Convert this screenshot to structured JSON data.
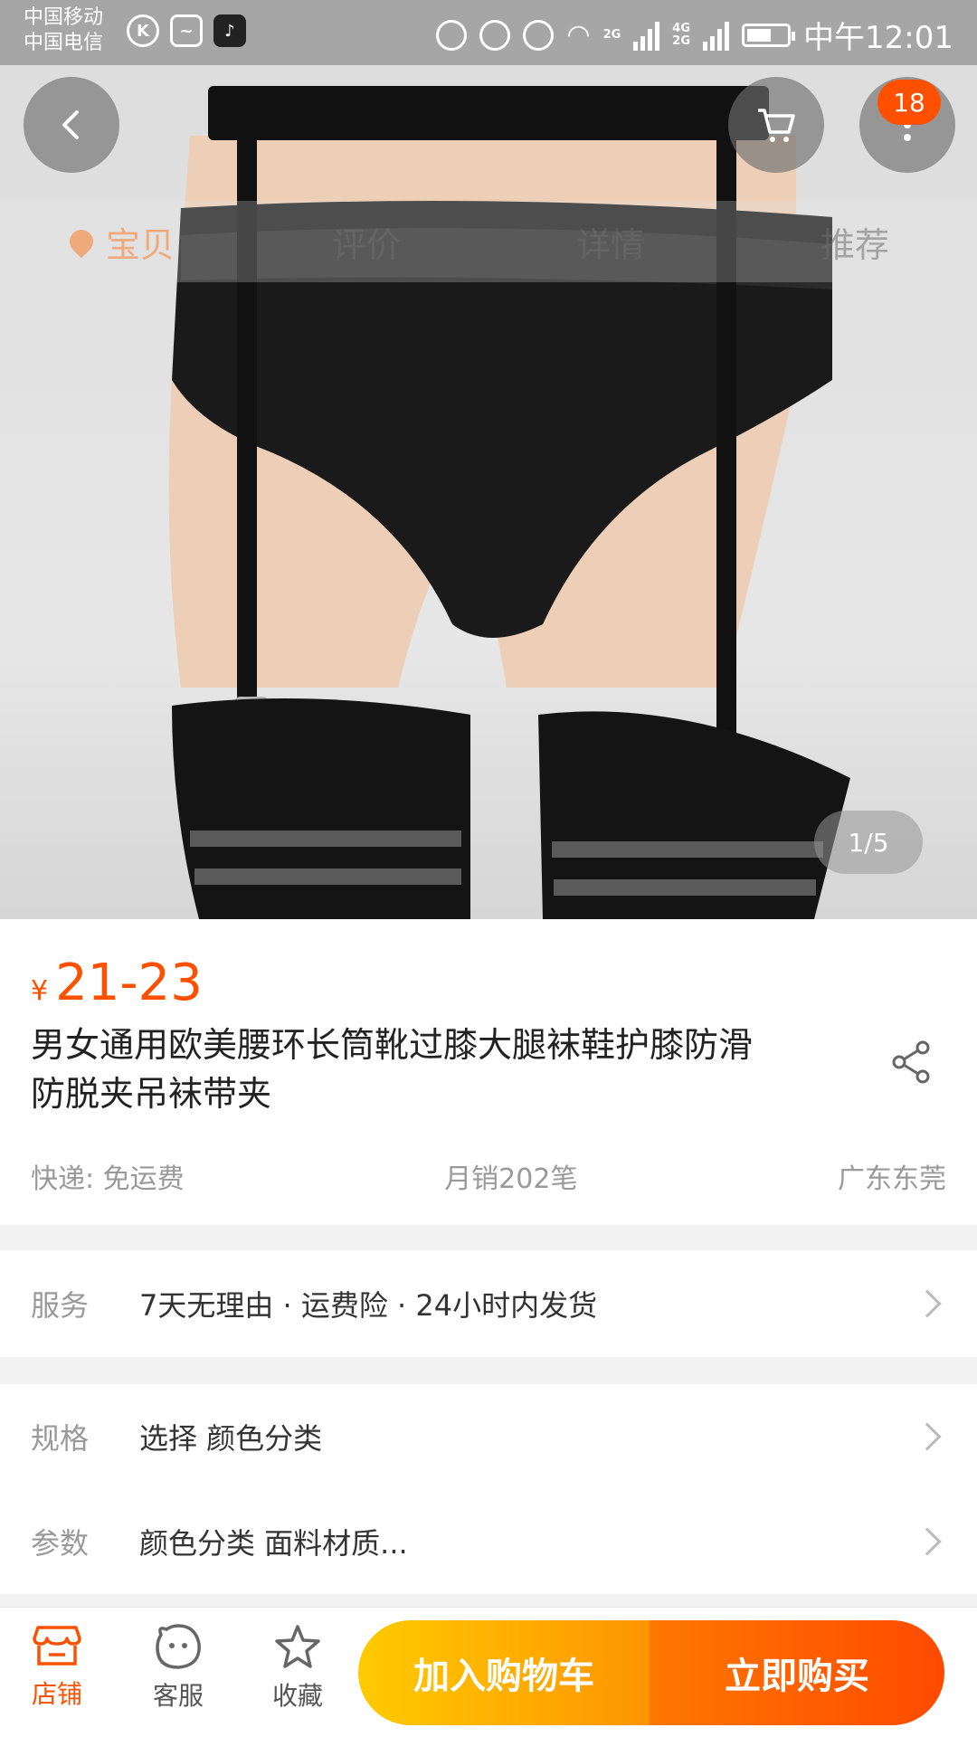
{
  "status_bar": {
    "carrier_1": "中国移动",
    "carrier_2": "中国电信",
    "network_label": "4G",
    "network_label_2": "2G",
    "signal_2g": "2G",
    "time": "中午12:01"
  },
  "header": {
    "cart_badge": "18",
    "tabs": [
      "宝贝",
      "评价",
      "详情",
      "推荐"
    ],
    "active_tab": "宝贝"
  },
  "gallery": {
    "page_indicator": "1/5"
  },
  "product": {
    "currency": "¥",
    "price": "21-23",
    "title": "男女通用欧美腰环长筒靴过膝大腿袜鞋护膝防滑防脱夹吊袜带夹",
    "shipping": "快递: 免运费",
    "monthly_sales": "月销202笔",
    "location": "广东东莞"
  },
  "rows": {
    "service_label": "服务",
    "service_value": "7天无理由 · 运费险 · 24小时内发货",
    "specs_label": "规格",
    "specs_value": "选择 颜色分类",
    "params_label": "参数",
    "params_value": "颜色分类 面料材质..."
  },
  "bottom_bar": {
    "shop": "店铺",
    "customer_service": "客服",
    "favorite": "收藏",
    "add_to_cart": "加入购物车",
    "buy_now": "立即购买"
  },
  "colors": {
    "accent": "#ff5000",
    "cart_button": "#ffb400",
    "buy_button": "#ff5500"
  }
}
